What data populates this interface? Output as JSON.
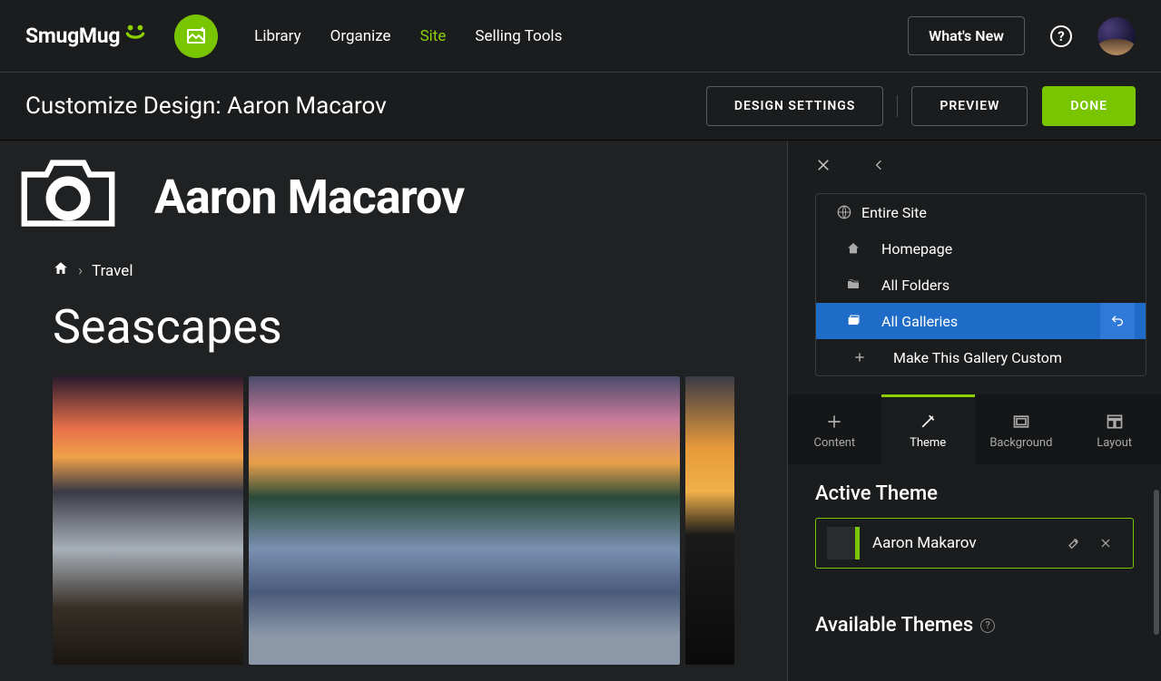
{
  "nav": {
    "logo": "SmugMug",
    "links": [
      "Library",
      "Organize",
      "Site",
      "Selling Tools"
    ],
    "active_link_index": 2,
    "whats_new": "What's New"
  },
  "subheader": {
    "title": "Customize Design: Aaron Macarov",
    "design_settings": "DESIGN SETTINGS",
    "preview": "PREVIEW",
    "done": "DONE"
  },
  "preview": {
    "site_name": "Aaron Macarov",
    "breadcrumb": "Travel",
    "gallery_title": "Seascapes"
  },
  "panel": {
    "scope": {
      "entire_site": "Entire Site",
      "homepage": "Homepage",
      "all_folders": "All Folders",
      "all_galleries": "All Galleries",
      "make_custom": "Make This Gallery Custom"
    },
    "tabs": {
      "content": "Content",
      "theme": "Theme",
      "background": "Background",
      "layout": "Layout",
      "active": "theme"
    },
    "active_theme": {
      "heading": "Active Theme",
      "name": "Aaron Makarov"
    },
    "available_themes": {
      "heading": "Available Themes"
    }
  }
}
